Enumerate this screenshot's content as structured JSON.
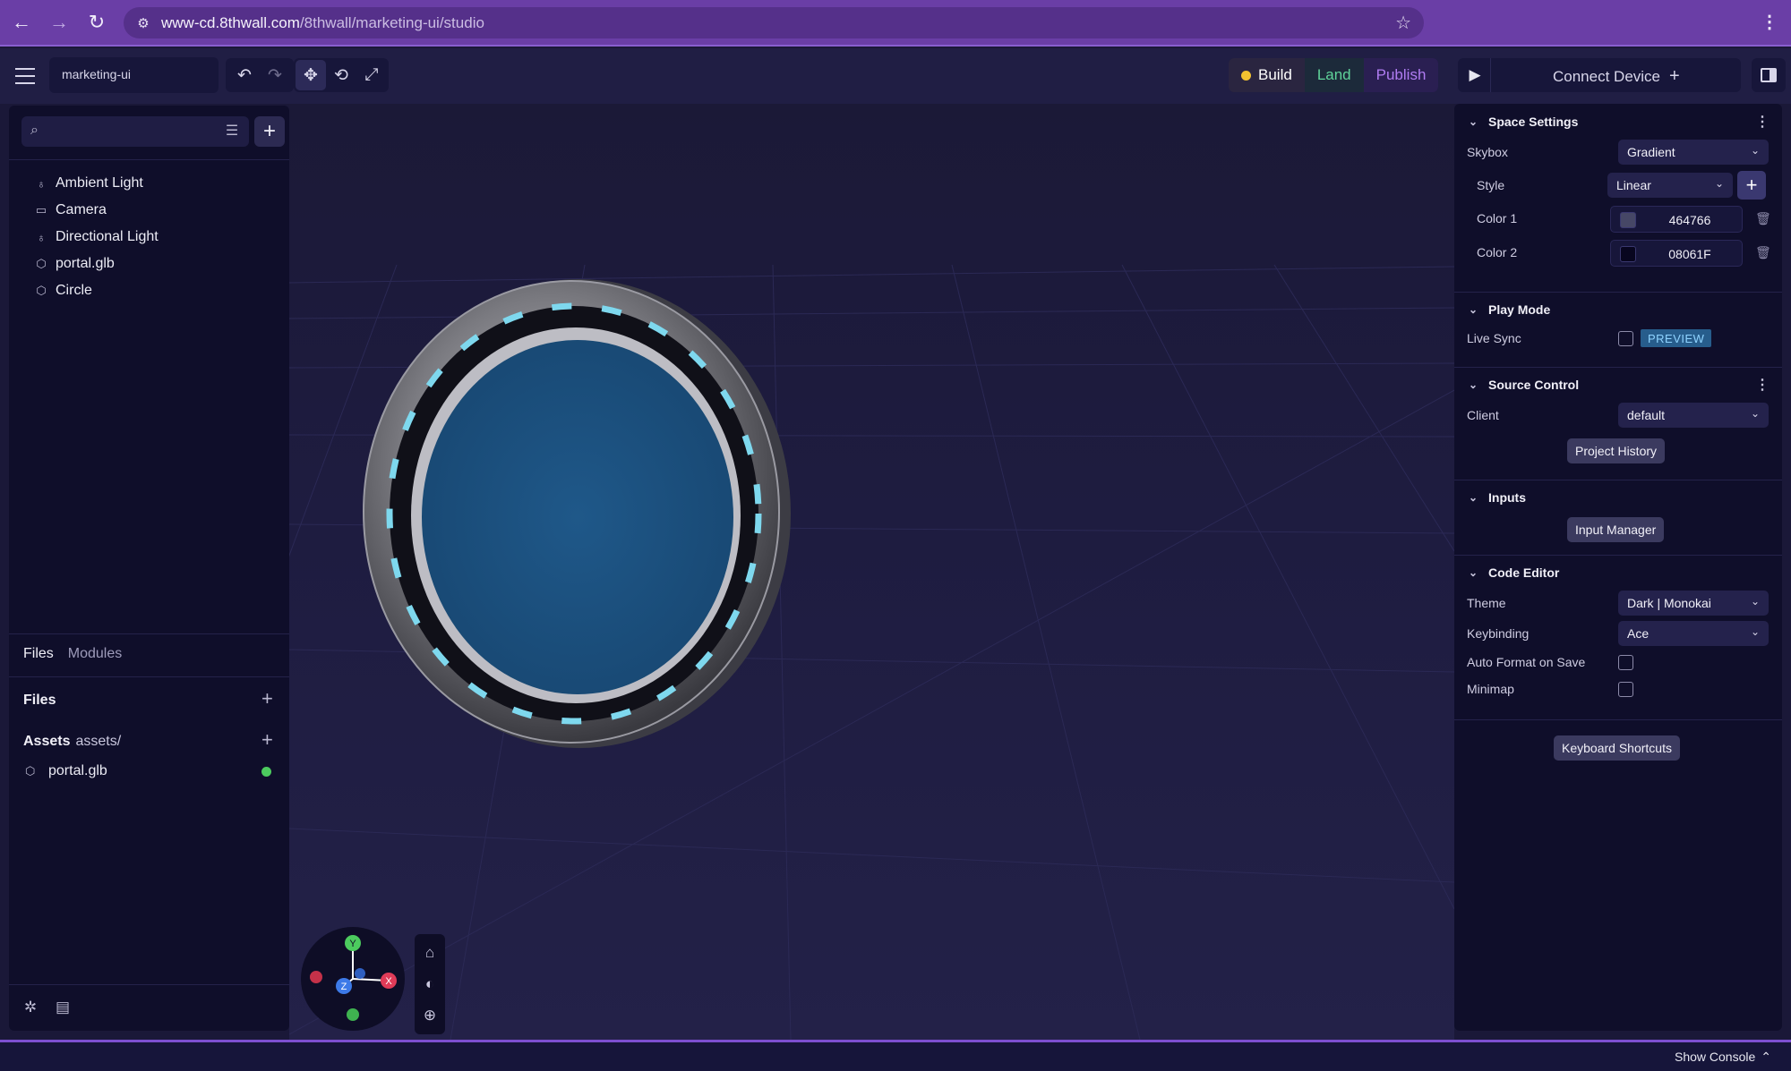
{
  "browser": {
    "url_host": "www-cd.8thwall.com",
    "url_path": "/8thwall/marketing-ui/studio"
  },
  "toolbar": {
    "project_name": "marketing-ui",
    "modes": {
      "build": "Build",
      "land": "Land",
      "publish": "Publish"
    },
    "connect_label": "Connect Device"
  },
  "hierarchy": {
    "search_placeholder": "",
    "items": [
      {
        "label": "Ambient Light",
        "icon": "bulb-icon"
      },
      {
        "label": "Camera",
        "icon": "camera-icon"
      },
      {
        "label": "Directional Light",
        "icon": "bulb-icon"
      },
      {
        "label": "portal.glb",
        "icon": "cube-icon"
      },
      {
        "label": "Circle",
        "icon": "cube-icon"
      }
    ]
  },
  "bottom_tabs": {
    "files": "Files",
    "modules": "Modules"
  },
  "files": {
    "heading": "Files",
    "assets_label": "Assets",
    "assets_path": "assets/",
    "asset_items": [
      {
        "label": "portal.glb",
        "status_color": "#4ccb5e"
      }
    ]
  },
  "space_settings": {
    "title": "Space Settings",
    "skybox_label": "Skybox",
    "skybox_value": "Gradient",
    "style_label": "Style",
    "style_value": "Linear",
    "color1_label": "Color 1",
    "color1_value": "464766",
    "color1_swatch": "#464766",
    "color2_label": "Color 2",
    "color2_value": "08061F",
    "color2_swatch": "#08061F"
  },
  "play_mode": {
    "title": "Play Mode",
    "live_sync_label": "Live Sync",
    "preview_badge": "PREVIEW"
  },
  "source_control": {
    "title": "Source Control",
    "client_label": "Client",
    "client_value": "default",
    "history_button": "Project History"
  },
  "inputs": {
    "title": "Inputs",
    "manager_button": "Input Manager"
  },
  "code_editor": {
    "title": "Code Editor",
    "theme_label": "Theme",
    "theme_value": "Dark | Monokai",
    "keybinding_label": "Keybinding",
    "keybinding_value": "Ace",
    "autoformat_label": "Auto Format on Save",
    "minimap_label": "Minimap"
  },
  "shortcuts_button": "Keyboard Shortcuts",
  "gizmo": {
    "y": "Y",
    "x": "X",
    "z": "Z"
  },
  "console_label": "Show Console"
}
